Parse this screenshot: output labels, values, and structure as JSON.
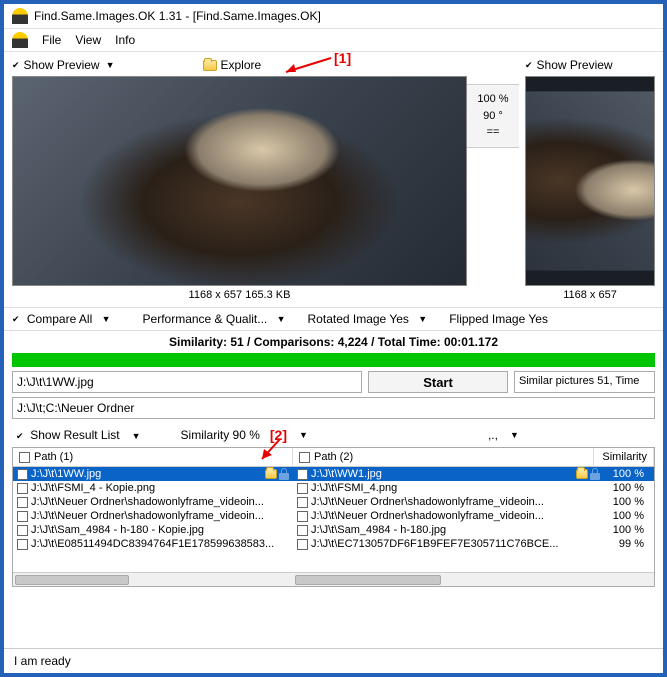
{
  "app": {
    "title": "Find.Same.Images.OK 1.31 - [Find.Same.Images.OK]",
    "menu": {
      "file": "File",
      "view": "View",
      "info": "Info"
    }
  },
  "preview": {
    "show_preview": "Show Preview",
    "explore": "Explore",
    "left_meta": "1168 x 657 165.3 KB",
    "right_meta": "1168 x 657",
    "match_pct": "100 %",
    "match_rot": "90 °",
    "match_eq": "=="
  },
  "annotations": {
    "one": "[1]",
    "two": "[2]"
  },
  "options": {
    "compare_all": "Compare All",
    "perf": "Performance & Qualit...",
    "rotated": "Rotated Image Yes",
    "flipped": "Flipped Image Yes"
  },
  "stats": "Similarity: 51 / Comparisons: 4,224 / Total Time: 00:01.172",
  "controls": {
    "path_value": "J:\\J\\t\\1WW.jpg",
    "start": "Start",
    "status_right": "Similar pictures 51, Time",
    "folder_value": "J:\\J\\t;C:\\Neuer Ordner",
    "show_result": "Show Result List",
    "similarity_opt": "Similarity 90 %",
    "dots": ",.,"
  },
  "table": {
    "col_path1": "Path (1)",
    "col_path2": "Path (2)",
    "col_sim": "Similarity",
    "left_rows": [
      "J:\\J\\t\\1WW.jpg",
      "J:\\J\\t\\FSMI_4 - Kopie.png",
      "J:\\J\\t\\Neuer Ordner\\shadowonlyframe_videoin...",
      "J:\\J\\t\\Neuer Ordner\\shadowonlyframe_videoin...",
      "J:\\J\\t\\Sam_4984 - h-180 - Kopie.jpg",
      "J:\\J\\t\\E08511494DC8394764F1E178599638583..."
    ],
    "right_rows": [
      {
        "p": "J:\\J\\t\\WW1.jpg",
        "s": "100 %"
      },
      {
        "p": "J:\\J\\t\\FSMI_4.png",
        "s": "100 %"
      },
      {
        "p": "J:\\J\\t\\Neuer Ordner\\shadowonlyframe_videoin...",
        "s": "100 %"
      },
      {
        "p": "J:\\J\\t\\Neuer Ordner\\shadowonlyframe_videoin...",
        "s": "100 %"
      },
      {
        "p": "J:\\J\\t\\Sam_4984 - h-180.jpg",
        "s": "100 %"
      },
      {
        "p": "J:\\J\\t\\EC713057DF6F1B9FEF7E305711C76BCE...",
        "s": "99 %"
      }
    ]
  },
  "statusbar": "I am ready"
}
